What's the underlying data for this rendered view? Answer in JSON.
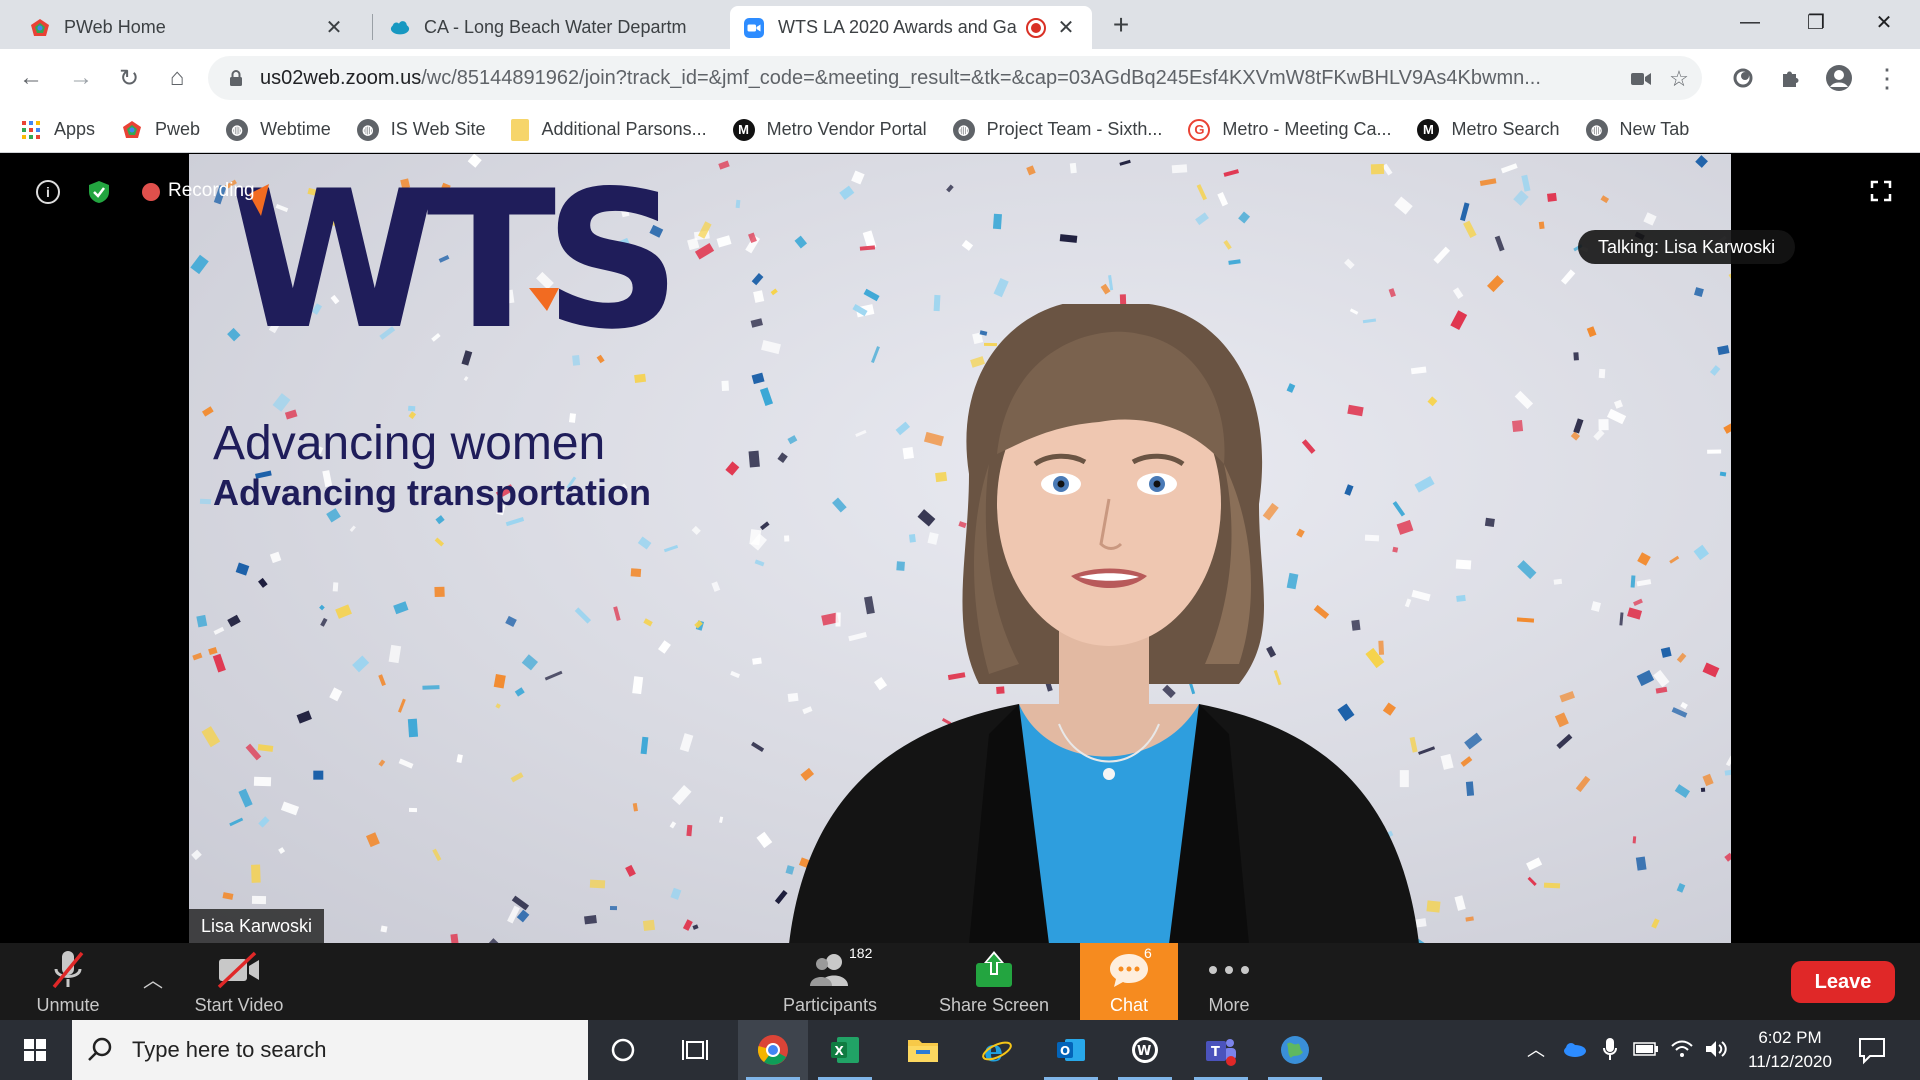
{
  "browser": {
    "tabs": [
      {
        "title": "PWeb Home",
        "icon": "pweb-favicon"
      },
      {
        "title": "CA - Long Beach Water Departm",
        "icon": "salesforce-cloud-favicon"
      },
      {
        "title": "WTS LA 2020 Awards and Ga",
        "icon": "zoom-favicon",
        "recording": true,
        "active": true
      }
    ],
    "new_tab_label": "+",
    "url_host": "us02web.zoom.us",
    "url_path": "/wc/85144891962/join?track_id=&jmf_code=&meeting_result=&tk=&cap=03AGdBq245Esf4KXVmW8tFKwBHLV9As4Kbwmn...",
    "bookmarks": [
      {
        "label": "Apps",
        "icon": "apps-grid-icon"
      },
      {
        "label": "Pweb",
        "icon": "pweb-icon"
      },
      {
        "label": "Webtime",
        "icon": "globe-icon"
      },
      {
        "label": "IS Web Site",
        "icon": "globe-icon"
      },
      {
        "label": "Additional Parsons...",
        "icon": "folder-icon"
      },
      {
        "label": "Metro Vendor Portal",
        "icon": "metro-m-icon"
      },
      {
        "label": "Project Team - Sixth...",
        "icon": "globe-icon"
      },
      {
        "label": "Metro - Meeting Ca...",
        "icon": "google-g-icon"
      },
      {
        "label": "Metro Search",
        "icon": "metro-m-icon"
      },
      {
        "label": "New Tab",
        "icon": "globe-icon"
      }
    ]
  },
  "meeting": {
    "recording_label": "Recording",
    "talking_label": "Talking: Lisa Karwoski",
    "speaker_name": "Lisa Karwoski",
    "logo_text": "WTS",
    "tagline_1": "Advancing women",
    "tagline_2": "Advancing transportation"
  },
  "zoom_toolbar": {
    "unmute": "Unmute",
    "start_video": "Start Video",
    "participants": "Participants",
    "participants_count": "182",
    "share_screen": "Share Screen",
    "chat": "Chat",
    "chat_count": "6",
    "more": "More",
    "leave": "Leave"
  },
  "taskbar": {
    "search_placeholder": "Type here to search",
    "time": "6:02 PM",
    "date": "11/12/2020"
  },
  "colors": {
    "zoom_blue": "#2d8cff",
    "chat_orange": "#f68b1f",
    "leave_red": "#e02828",
    "wts_navy": "#1f1d5a",
    "wts_orange": "#f26b21"
  }
}
